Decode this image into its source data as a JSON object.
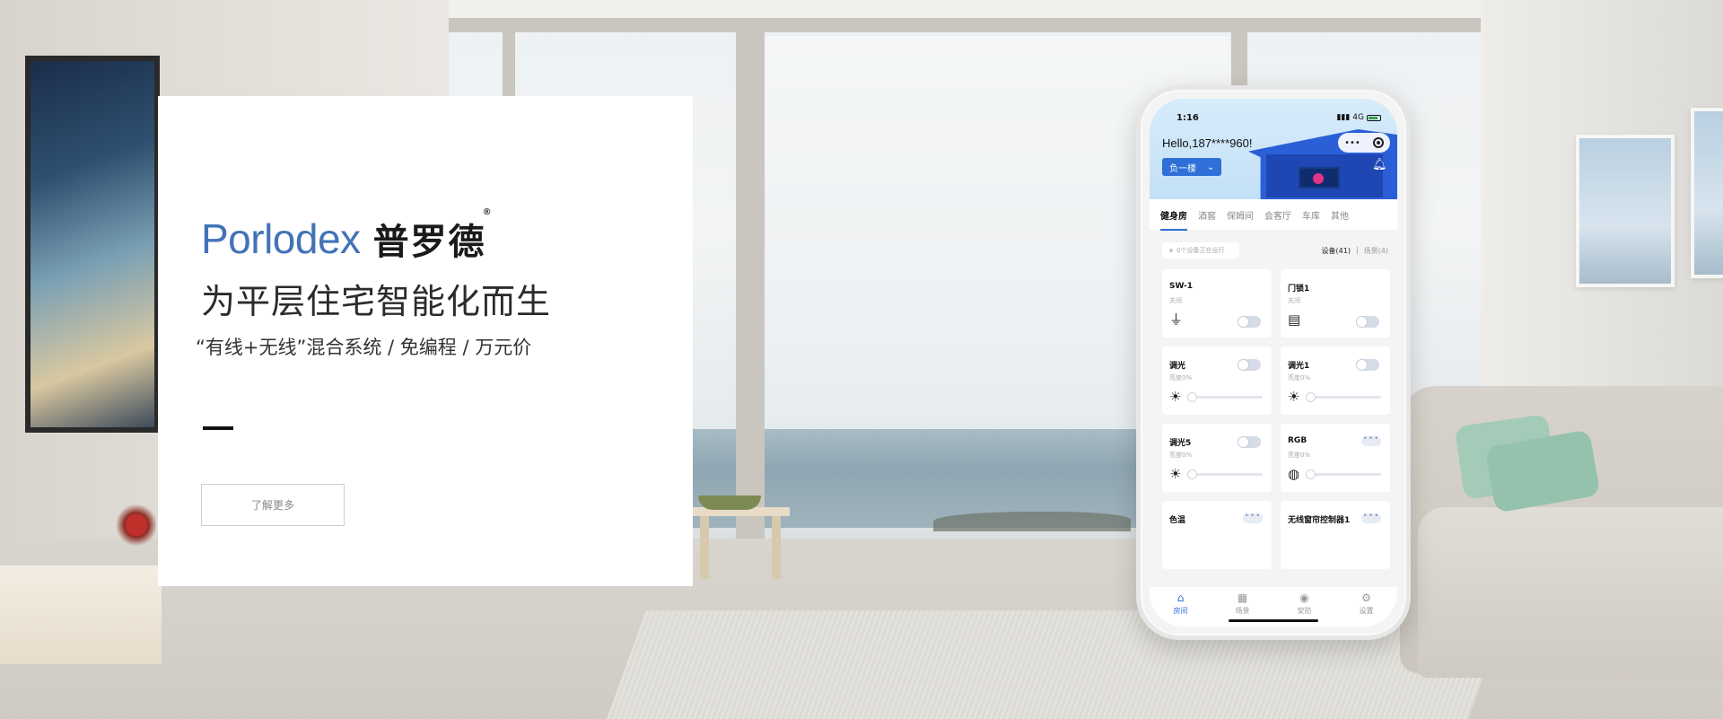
{
  "brand": {
    "latin": "Porlodex",
    "chinese": "普罗德",
    "registered": "®"
  },
  "hero": {
    "tagline": "为平层住宅智能化而生",
    "sub_tagline": "“有线+无线”混合系统 / 免编程 / 万元价",
    "cta_label": "了解更多"
  },
  "phone": {
    "status": {
      "time": "1:16",
      "network": "4G"
    },
    "greeting": "Hello,187****960!",
    "floor_selector": "负一楼",
    "capsule_more": "•••",
    "room_tabs": [
      "健身房",
      "酒窖",
      "保姆间",
      "会客厅",
      "车库",
      "其他"
    ],
    "active_tab": "健身房",
    "running_status": "0个设备正在运行",
    "counts": {
      "devices": "设备(41)",
      "scenes": "场景(4)"
    },
    "devices": [
      {
        "name": "SW-1",
        "status": "关闭",
        "icon": "ceiling-lamp-icon",
        "glyph": "⏚"
      },
      {
        "name": "门锁1",
        "status": "关闭",
        "icon": "door-lock-icon",
        "glyph": "▤"
      },
      {
        "name": "调光",
        "status": "亮度0%",
        "icon": "brightness-icon",
        "glyph": "☀"
      },
      {
        "name": "调光1",
        "status": "亮度0%",
        "icon": "brightness-icon",
        "glyph": "☀"
      },
      {
        "name": "调光5",
        "status": "亮度0%",
        "icon": "brightness-icon",
        "glyph": "☀"
      },
      {
        "name": "RGB",
        "status": "亮度0%",
        "icon": "palette-icon",
        "glyph": "◍"
      },
      {
        "name": "色温",
        "status": "",
        "icon": "",
        "glyph": ""
      },
      {
        "name": "无线窗帘控制器1",
        "status": "",
        "icon": "",
        "glyph": ""
      }
    ],
    "more_dots": "•••",
    "bottom_tabs": [
      {
        "label": "房间",
        "icon": "home-icon",
        "glyph": "⌂"
      },
      {
        "label": "场景",
        "icon": "scenes-grid-icon",
        "glyph": "▦"
      },
      {
        "label": "安防",
        "icon": "security-camera-icon",
        "glyph": "◉"
      },
      {
        "label": "设置",
        "icon": "settings-gear-icon",
        "glyph": "⚙"
      }
    ]
  },
  "colors": {
    "brand_blue": "#4273b6",
    "app_accent": "#2f6fd8",
    "toggle_off": "#d5dbe7"
  }
}
